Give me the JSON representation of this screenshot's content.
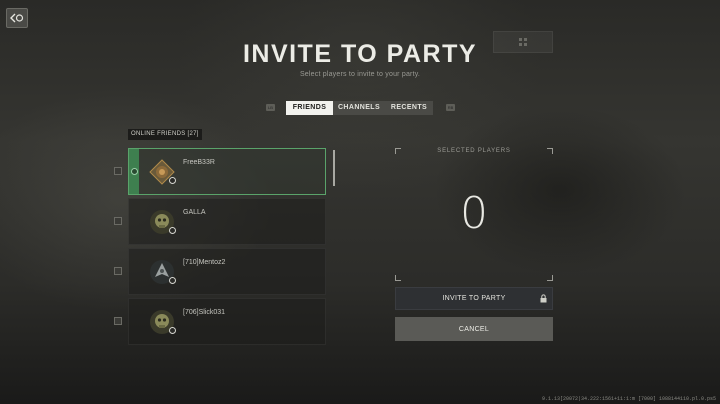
{
  "header": {
    "title": "INVITE TO PARTY",
    "subtitle": "Select players to invite to your party."
  },
  "icons": {
    "back": "back-arrow-icon",
    "grid": "grid-icon",
    "lock": "lock-icon"
  },
  "tabs": [
    {
      "label": "FRIENDS",
      "active": true
    },
    {
      "label": "CHANNELS",
      "active": false
    },
    {
      "label": "RECENTS",
      "active": false
    }
  ],
  "tab_hints": {
    "left": "LB",
    "right": "RB"
  },
  "friends": {
    "label": "ONLINE FRIENDS [27]",
    "items": [
      {
        "name": "FreeB33R",
        "selected": true
      },
      {
        "name": "GALLA",
        "selected": false
      },
      {
        "name": "[710]Mentoz2",
        "selected": false
      },
      {
        "name": "[706]Slick031",
        "selected": false
      }
    ]
  },
  "selected_players": {
    "label": "SELECTED PLAYERS",
    "count": "0"
  },
  "buttons": {
    "invite": "INVITE TO PARTY",
    "cancel": "CANCEL"
  },
  "version": "9.1.13[20072|34.222:1561+11:1:m [7000] 1088144110.pl.0.ps5"
}
